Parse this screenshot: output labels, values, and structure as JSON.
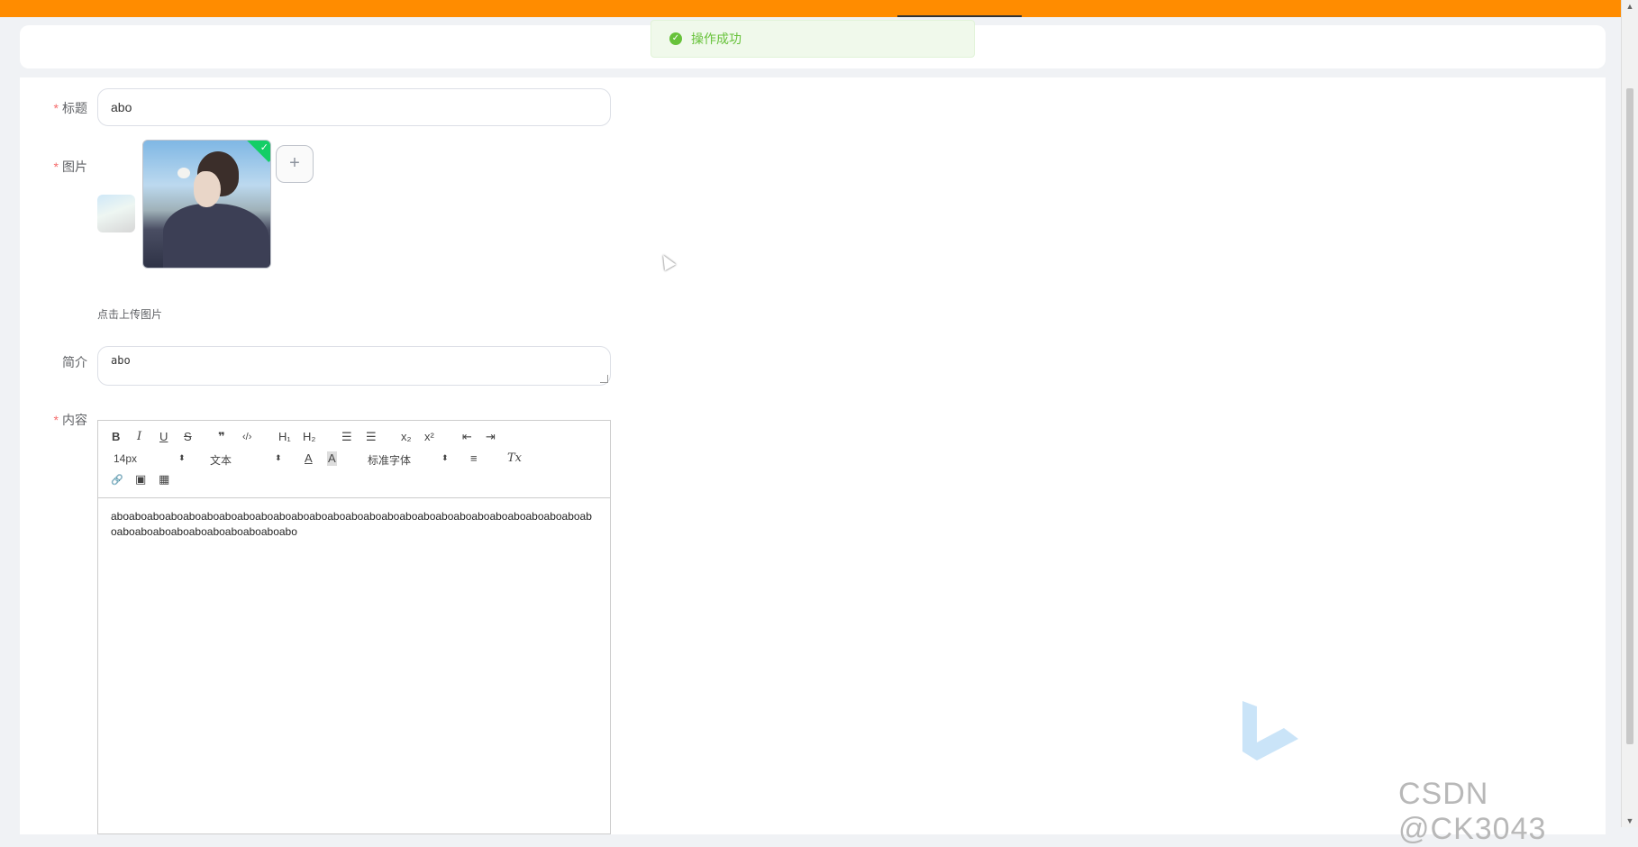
{
  "toast": {
    "message": "操作成功"
  },
  "form": {
    "title": {
      "label": "标题",
      "value": "abo"
    },
    "image": {
      "label": "图片",
      "upload_tip": "点击上传图片",
      "add_symbol": "+"
    },
    "intro": {
      "label": "简介",
      "value": "abo"
    },
    "content": {
      "label": "内容",
      "value": "aboaboaboaboaboaboaboaboaboaboaboaboaboaboaboaboaboaboaboaboaboaboaboaboaboaboaboaboaboaboaboaboaboaboaboaboabo"
    }
  },
  "toolbar": {
    "bold": "B",
    "italic": "I",
    "underline": "U",
    "strike": "S",
    "blockquote": "❞",
    "code": "‹/›",
    "h1": "H₁",
    "h2": "H₂",
    "ordered_list": "☰",
    "bullet_list": "☰",
    "sub": "x₂",
    "sup": "x²",
    "outdent": "⇤",
    "indent": "⇥",
    "size": "14px",
    "header": "文本",
    "color": "A",
    "background": "A",
    "font": "标准字体",
    "align": "≡",
    "clean": "Tx",
    "link": "🔗",
    "image": "▣",
    "video": "▦"
  },
  "watermark": "CSDN @CK3043",
  "colors": {
    "accent": "#ff8c00",
    "success": "#67c23a",
    "required": "#f56c6c"
  }
}
